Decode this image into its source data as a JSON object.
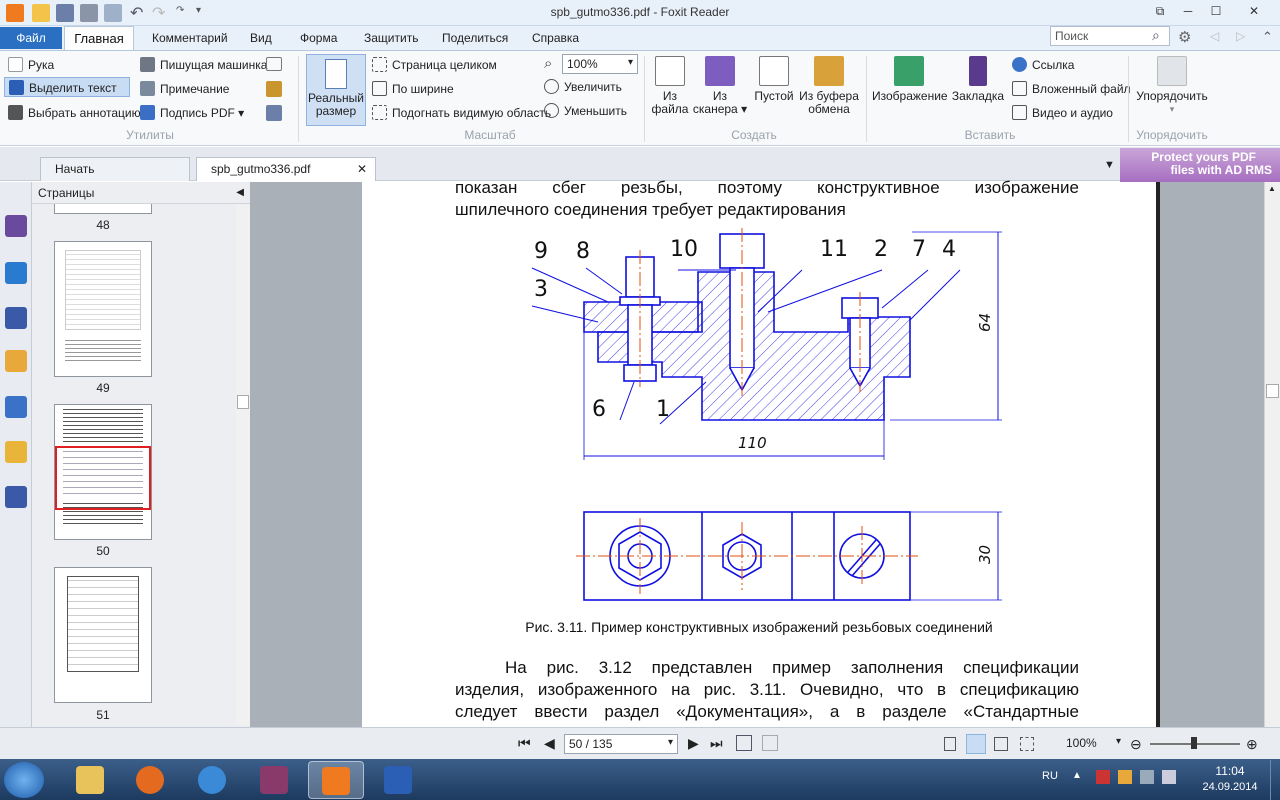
{
  "window": {
    "title": "spb_gutmo336.pdf - Foxit Reader"
  },
  "ribbon_tabs": [
    "Файл",
    "Главная",
    "Комментарий",
    "Вид",
    "Форма",
    "Защитить",
    "Поделиться",
    "Справка"
  ],
  "search": {
    "placeholder": "Поиск"
  },
  "ribbon": {
    "tools": [
      "Рука",
      "Выделить текст",
      "Выбрать аннотацию"
    ],
    "tools2": [
      "Пишущая машинка",
      "Примечание",
      "Подпись PDF"
    ],
    "utilities_label": "Утилиты",
    "actual_size": [
      "Реальный",
      "размер"
    ],
    "zoom_items": [
      "Страница целиком",
      "По ширине",
      "Подогнать видимую область"
    ],
    "zoom_value": "100%",
    "zoom_in": "Увеличить",
    "zoom_out": "Уменьшить",
    "scale_label": "Масштаб",
    "create": [
      [
        "Из",
        "файла"
      ],
      [
        "Из",
        "сканера"
      ],
      [
        "Пустой",
        ""
      ],
      [
        "Из буфера",
        "обмена"
      ]
    ],
    "create_label": "Создать",
    "insert_big": [
      "Изображение",
      "Закладка"
    ],
    "insert_small": [
      "Ссылка",
      "Вложенный файл",
      "Видео и аудио"
    ],
    "insert_label": "Вставить",
    "arrange": "Упорядочить",
    "arrange_label": "Упорядочить"
  },
  "doc_tabs": [
    "Начать",
    "spb_gutmo336.pdf"
  ],
  "ad": [
    "Protect yours PDF",
    "files with AD RMS"
  ],
  "thumbnails": {
    "header": "Страницы",
    "pages": [
      "48",
      "49",
      "50",
      "51"
    ]
  },
  "document": {
    "para1_line1": "показан сбег резьбы, поэтому конструктивное изображение",
    "para1_line2": "шпилечного соединения требует редактирования",
    "drawing_labels": [
      "9",
      "8",
      "10",
      "11",
      "2",
      "7",
      "4",
      "3",
      "6",
      "1"
    ],
    "dim_height": "64",
    "dim_width": "110",
    "dim_plan": "30",
    "caption": "Рис. 3.11. Пример конструктивных изображений резьбовых соединений",
    "para2_line1": "На рис. 3.12 представлен пример заполнения спецификации",
    "para2_line2": "изделия, изображенного на рис. 3.11. Очевидно, что в спецификацию",
    "para2_line3": "следует ввести раздел «Документация», а в разделе «Стандартные"
  },
  "statusbar": {
    "page": "50 / 135",
    "zoom": "100%"
  },
  "tray": {
    "lang": "RU",
    "time": "11:04",
    "date": "24.09.2014"
  },
  "colors": {
    "accent": "#2b6fc2",
    "drawing_blue": "#1010e0",
    "centerline": "#e05010",
    "thumb_highlight": "#e02020"
  }
}
